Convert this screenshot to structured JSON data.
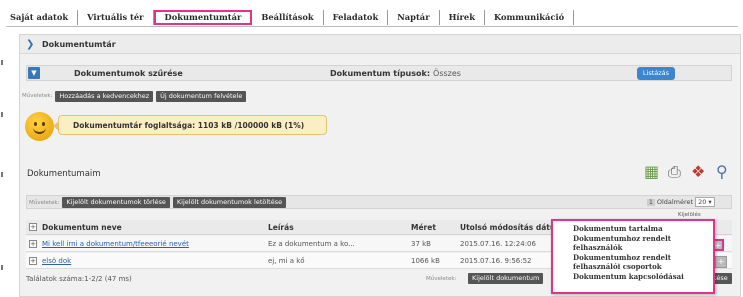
{
  "nav": {
    "tabs": [
      {
        "label": "Saját adatok"
      },
      {
        "label": "Virtuális tér"
      },
      {
        "label": "Dokumentumtár"
      },
      {
        "label": "Beállítások"
      },
      {
        "label": "Feladatok"
      },
      {
        "label": "Naptár"
      },
      {
        "label": "Hírek"
      },
      {
        "label": "Kommunikáció"
      }
    ],
    "active_tab": "Dokumentumtár"
  },
  "header": {
    "title": "Dokumentumtár",
    "icon": "chevron-right-icon"
  },
  "filter": {
    "label": "Dokumentumok szűrése",
    "type_label": "Dokumentum típusok:",
    "type_value": "Összes",
    "list_button": "Listázás"
  },
  "actions_top": {
    "label": "Műveletek:",
    "buttons": [
      "Hozzáadás a kedvencekhez",
      "Új dokumentum felvétele"
    ]
  },
  "usage": {
    "text": "Dokumentumtár foglaltsága: 1103 kB /100000 kB (1%)",
    "icon": "smiley-icon"
  },
  "docs": {
    "title": "Dokumentumaim",
    "tool_icons": [
      "spreadsheet-icon",
      "printer-icon",
      "pin-icon",
      "search-icon"
    ]
  },
  "actions_mid": {
    "label": "Műveletek:",
    "buttons": [
      "Kijelölt dokumentumok törlése",
      "Kijelölt dokumentumok letöltése"
    ],
    "page_num": "1",
    "page_size_label": "Oldalméret",
    "page_size_value": "20",
    "toggle_link": "Kijelölés"
  },
  "table": {
    "columns": [
      "Dokumentum neve",
      "Leírás",
      "Méret",
      "Utolsó módosítás dátuma"
    ],
    "rows": [
      {
        "name": "Mi kell írni a dokumentum/tfeeeorié nevét",
        "desc": "Ez a dokumentum a ko...",
        "size": "37 kB",
        "date": "2015.07.16. 12:24:06"
      },
      {
        "name": "elsö dok",
        "desc": "ej, mi a kő",
        "size": "1066 kB",
        "date": "2015.07.16. 9:56:52"
      }
    ]
  },
  "footer": {
    "count": "Találatok száma:1-2/2 (47 ms)",
    "label": "Műveletek:",
    "button": "Kijelölt dokumentum",
    "button_right": "ltése"
  },
  "context_menu": {
    "items": [
      "Dokumentum tartalma",
      "Dokumentumhoz rendelt felhasználók",
      "Dokumentumhoz rendelt felhasználói csoportok",
      "Dokumentum kapcsolódásai"
    ]
  },
  "colors": {
    "accent": "#3c86cf",
    "highlight": "#e0338a",
    "usage_bg": "#fbeec4"
  }
}
